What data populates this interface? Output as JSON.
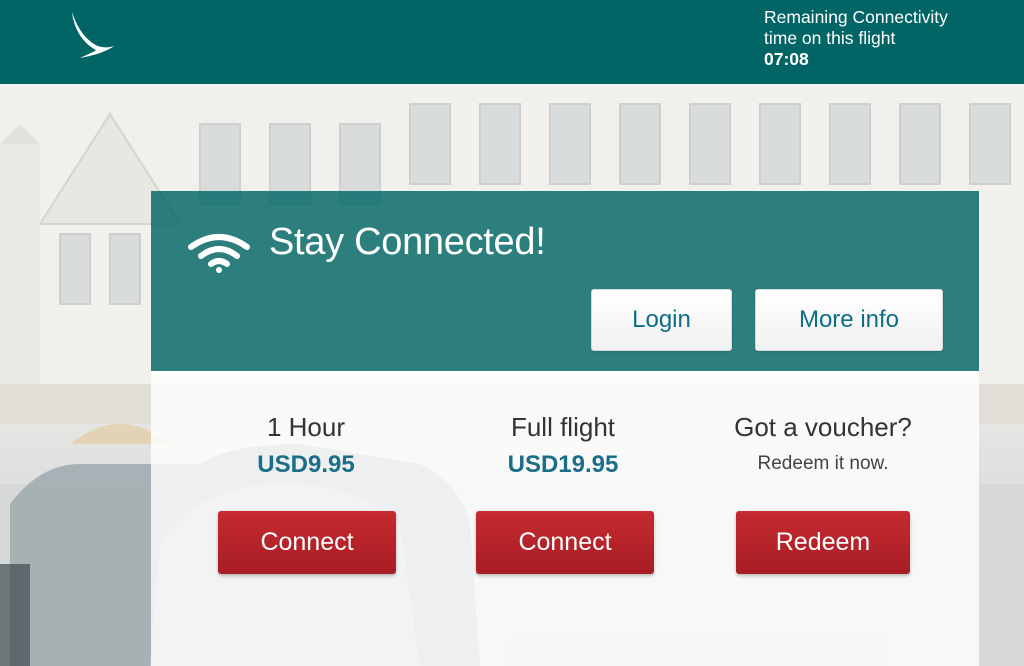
{
  "header": {
    "remaining_line1": "Remaining Connectivity",
    "remaining_line2": "time on this flight",
    "remaining_time": "07:08"
  },
  "panel": {
    "title": "Stay Connected!",
    "login_label": "Login",
    "more_info_label": "More info"
  },
  "plans": [
    {
      "name": "1 Hour",
      "price": "USD9.95",
      "button": "Connect"
    },
    {
      "name": "Full flight",
      "price": "USD19.95",
      "button": "Connect"
    }
  ],
  "voucher": {
    "title": "Got a voucher?",
    "subtitle": "Redeem it now.",
    "button": "Redeem"
  },
  "colors": {
    "brand": "#006564",
    "accent_red": "#b8252b",
    "price": "#1a6e8a"
  },
  "icons": [
    "airline-logo-icon",
    "wifi-icon"
  ]
}
